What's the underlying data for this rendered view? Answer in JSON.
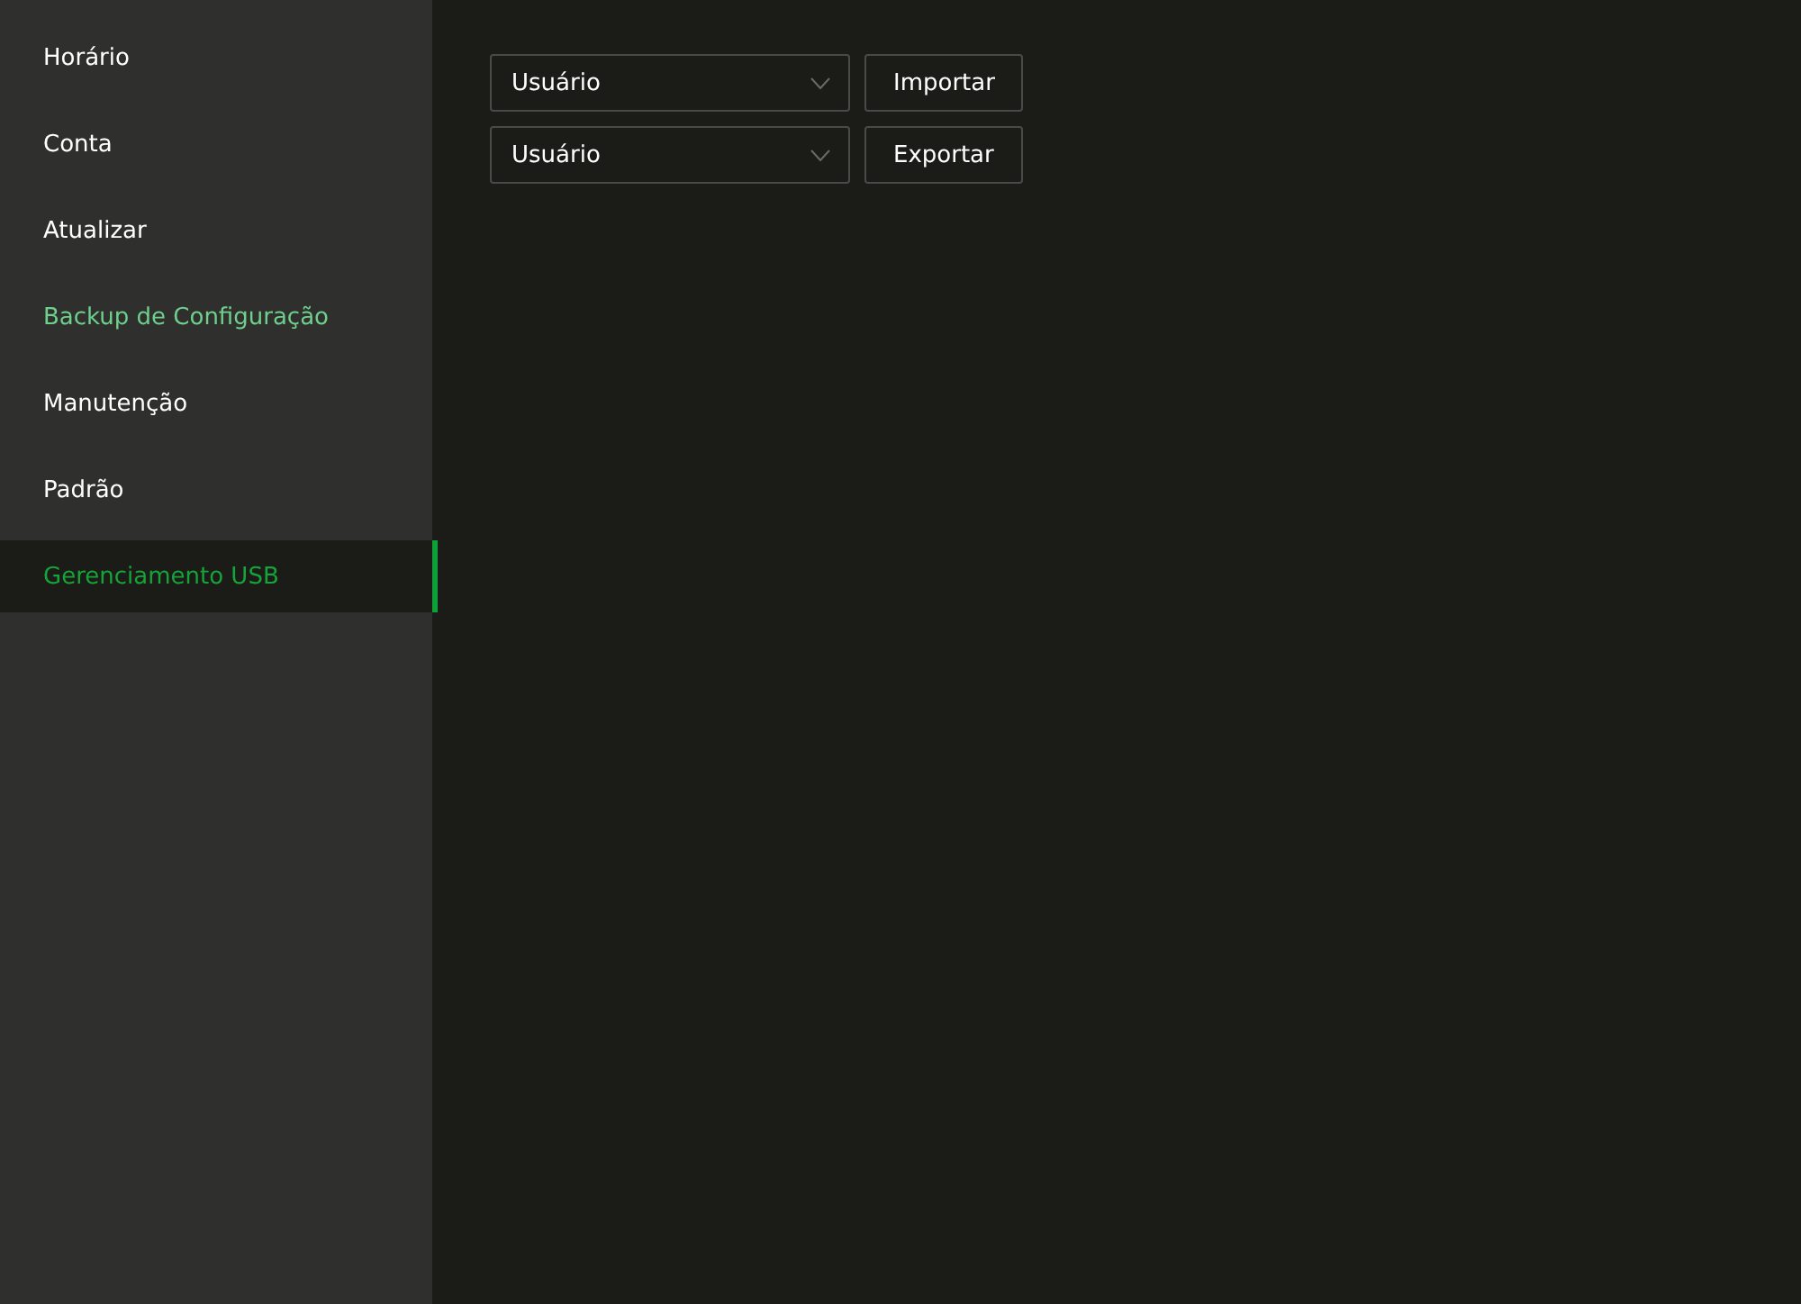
{
  "sidebar": {
    "items": [
      {
        "label": "Horário",
        "selected": false,
        "hovered": false
      },
      {
        "label": "Conta",
        "selected": false,
        "hovered": false
      },
      {
        "label": "Atualizar",
        "selected": false,
        "hovered": false
      },
      {
        "label": "Backup de Configuração",
        "selected": false,
        "hovered": true
      },
      {
        "label": "Manutenção",
        "selected": false,
        "hovered": false
      },
      {
        "label": "Padrão",
        "selected": false,
        "hovered": false
      },
      {
        "label": "Gerenciamento USB",
        "selected": true,
        "hovered": false
      }
    ]
  },
  "actions": [
    {
      "select": "Usuário",
      "button": "Importar"
    },
    {
      "select": "Usuário",
      "button": "Exportar"
    }
  ]
}
